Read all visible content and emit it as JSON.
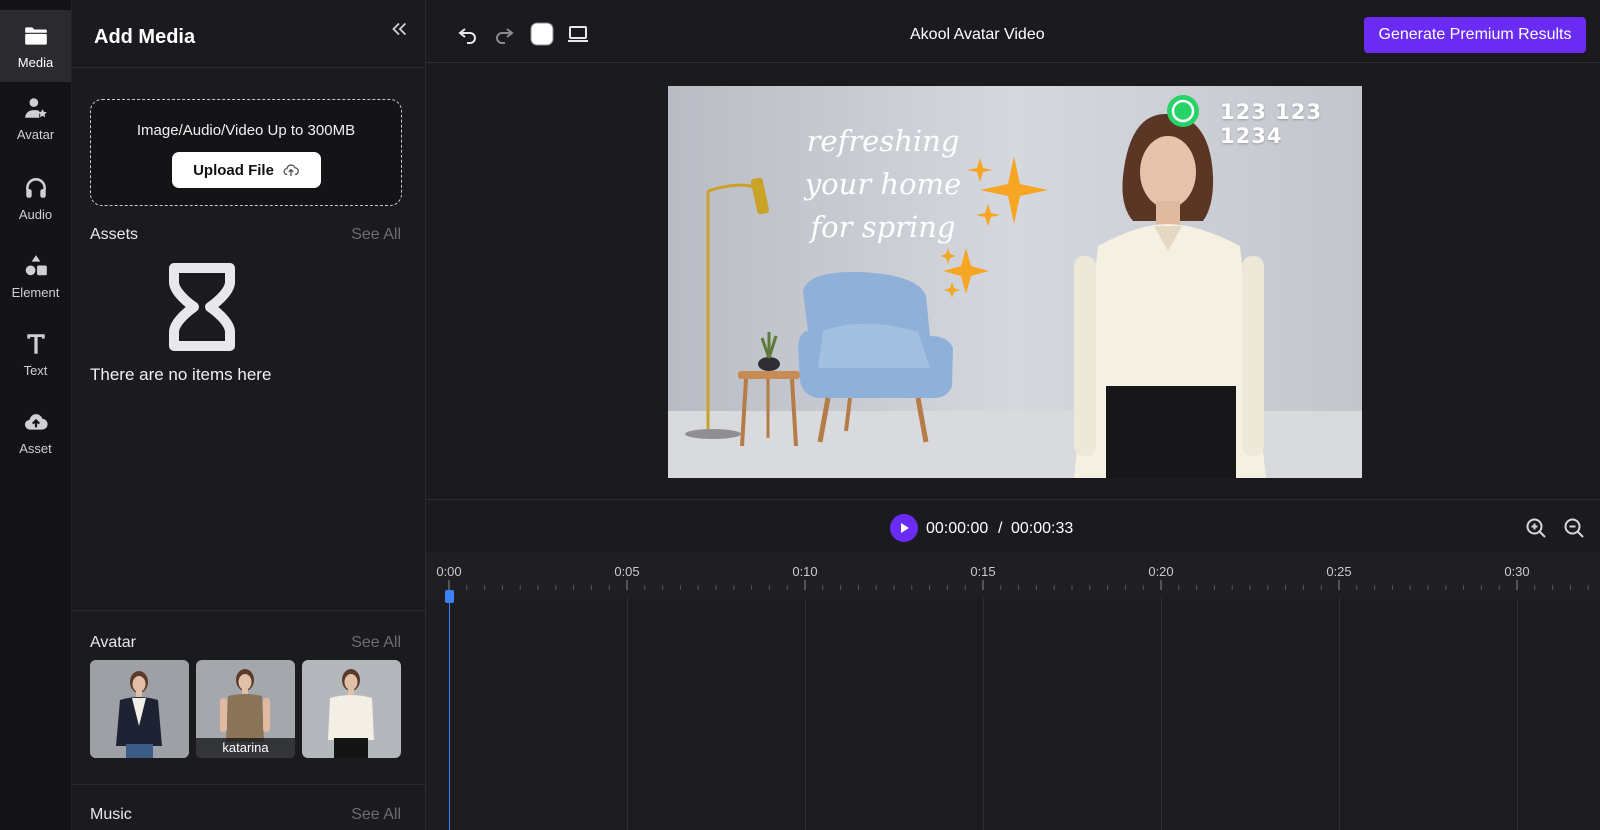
{
  "rail": {
    "items": [
      {
        "label": "Media",
        "icon": "folder-icon",
        "active": true
      },
      {
        "label": "Avatar",
        "icon": "user-star-icon"
      },
      {
        "label": "Audio",
        "icon": "headphones-icon"
      },
      {
        "label": "Element",
        "icon": "shapes-icon"
      },
      {
        "label": "Text",
        "icon": "text-t-icon"
      },
      {
        "label": "Asset",
        "icon": "cloud-upload-icon"
      }
    ]
  },
  "panel": {
    "title": "Add Media",
    "upload": {
      "hint": "Image/Audio/Video Up to 300MB",
      "button_label": "Upload File"
    },
    "assets": {
      "title": "Assets",
      "see_all": "See All",
      "empty_text": "There are no items here"
    },
    "avatar": {
      "title": "Avatar",
      "see_all": "See All",
      "thumbs": [
        {
          "label": ""
        },
        {
          "label": "katarina"
        },
        {
          "label": ""
        }
      ]
    },
    "music": {
      "title": "Music",
      "see_all": "See All"
    }
  },
  "toolbar": {
    "project_title": "Akool Avatar Video",
    "premium_button": "Generate Premium Results"
  },
  "canvas": {
    "phone": "123 123 1234",
    "overlay_lines": [
      "refreshing",
      "your home",
      "for spring"
    ]
  },
  "timeline": {
    "current_time": "00:00:00",
    "separator": "/",
    "total_time": "00:00:33",
    "ticks": [
      "0:00",
      "0:05",
      "0:10",
      "0:15",
      "0:20",
      "0:25",
      "0:30"
    ]
  },
  "colors": {
    "accent": "#6a2cf5",
    "playhead": "#3b82f6",
    "whatsapp": "#25d366",
    "sparkle": "#f6a623"
  }
}
